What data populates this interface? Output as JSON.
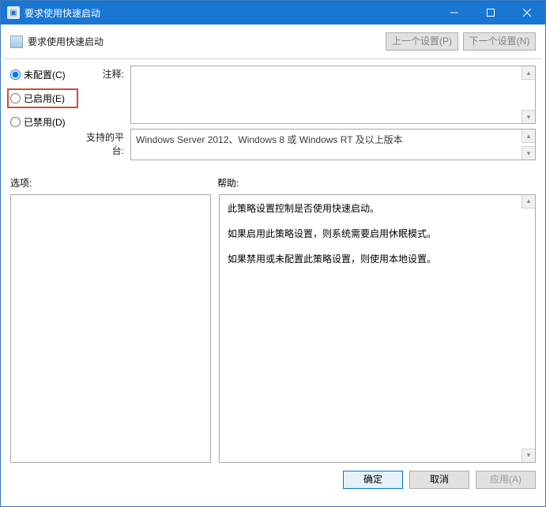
{
  "window": {
    "title": "要求使用快速启动"
  },
  "toolbar": {
    "label": "要求使用快速启动",
    "prev_setting": "上一个设置(P)",
    "next_setting": "下一个设置(N)"
  },
  "radios": {
    "not_configured": "未配置(C)",
    "enabled": "已启用(E)",
    "disabled": "已禁用(D)",
    "selected": "not_configured",
    "highlighted": "enabled"
  },
  "fields": {
    "comment_label": "注释:",
    "comment_value": "",
    "platform_label": "支持的平台:",
    "platform_value": "Windows Server 2012、Windows 8 或 Windows RT 及以上版本"
  },
  "lower": {
    "options_label": "选项:",
    "help_label": "帮助:"
  },
  "help": {
    "p1": "此策略设置控制是否使用快速启动。",
    "p2": "如果启用此策略设置，则系统需要启用休眠模式。",
    "p3": "如果禁用或未配置此策略设置，则使用本地设置。"
  },
  "footer": {
    "ok": "确定",
    "cancel": "取消",
    "apply": "应用(A)"
  }
}
